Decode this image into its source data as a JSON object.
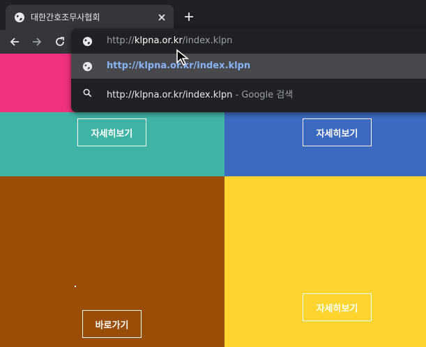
{
  "browser": {
    "tab_title": "대한간호조무사협회",
    "address": {
      "scheme": "http://",
      "host": "klpna.or.kr",
      "path": "/index.klpn"
    },
    "suggestions": [
      {
        "text": "http://klpna.or.kr/index.klpn",
        "icon": "globe-icon"
      },
      {
        "text": "http://klpna.or.kr/index.klpn",
        "suffix": " - Google 검색",
        "icon": "search-icon"
      }
    ]
  },
  "page": {
    "colors": {
      "pink": "#f0327f",
      "teal": "#40b4a4",
      "blue": "#3d6ac1",
      "brown": "#9a4d07",
      "yellow": "#fed52e"
    },
    "buttons": {
      "teal": "자세히보기",
      "blue": "자세히보기",
      "brown": "바로가기",
      "yellow": "자세히보기"
    }
  }
}
